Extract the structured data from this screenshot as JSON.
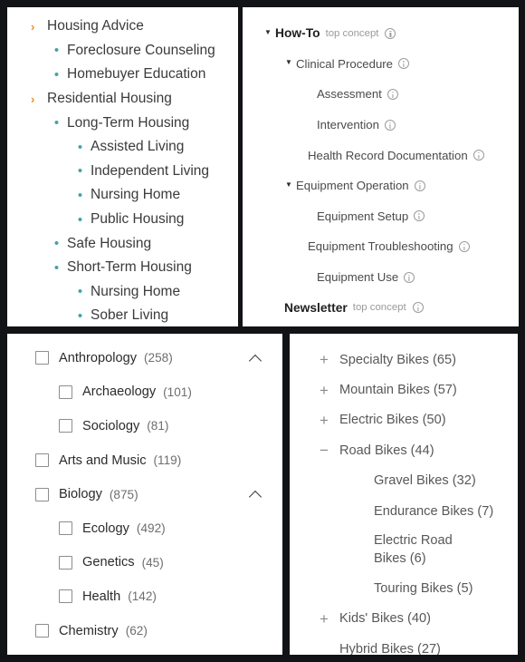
{
  "colors": {
    "background": "#121316",
    "panel": "#ffffff",
    "chevron_orange": "#e8912a",
    "bullet_teal": "#46a3a0",
    "text_primary": "#2b2b2e",
    "text_muted": "#9a9a9e"
  },
  "panel_housing": {
    "name": "Housing taxonomy tree",
    "items": [
      {
        "label": "Housing Advice",
        "marker": "chevron-right",
        "level": 0
      },
      {
        "label": "Foreclosure Counseling",
        "marker": "bullet",
        "level": 1
      },
      {
        "label": "Homebuyer Education",
        "marker": "bullet",
        "level": 1
      },
      {
        "label": "Residential Housing",
        "marker": "chevron-right",
        "level": 0
      },
      {
        "label": "Long-Term Housing",
        "marker": "bullet",
        "level": 1
      },
      {
        "label": "Assisted Living",
        "marker": "bullet",
        "level": 2
      },
      {
        "label": "Independent Living",
        "marker": "bullet",
        "level": 2
      },
      {
        "label": "Nursing Home",
        "marker": "bullet",
        "level": 2
      },
      {
        "label": "Public Housing",
        "marker": "bullet",
        "level": 2
      },
      {
        "label": "Safe Housing",
        "marker": "bullet",
        "level": 1
      },
      {
        "label": "Short-Term Housing",
        "marker": "bullet",
        "level": 1
      },
      {
        "label": "Nursing Home",
        "marker": "bullet",
        "level": 2
      },
      {
        "label": "Sober Living",
        "marker": "bullet",
        "level": 2
      }
    ],
    "chevron_glyph": "›",
    "bullet_glyph": "•"
  },
  "panel_howto": {
    "name": "How-To concept hierarchy",
    "caret_open_glyph": "▼",
    "items": [
      {
        "label": "How-To",
        "tag": "top concept",
        "caret": true,
        "bold": true,
        "depth": 0,
        "info": true
      },
      {
        "label": "Clinical Procedure",
        "tag": "",
        "caret": true,
        "bold": false,
        "depth": 1,
        "info": true
      },
      {
        "label": "Assessment",
        "tag": "",
        "caret": false,
        "bold": false,
        "depth": 2,
        "info": true
      },
      {
        "label": "Intervention",
        "tag": "",
        "caret": false,
        "bold": false,
        "depth": 2,
        "info": true
      },
      {
        "label": "Health Record Documentation",
        "tag": "",
        "caret": false,
        "bold": false,
        "depth": 2,
        "info": true
      },
      {
        "label": "Equipment Operation",
        "tag": "",
        "caret": true,
        "bold": false,
        "depth": 1,
        "info": true
      },
      {
        "label": "Equipment Setup",
        "tag": "",
        "caret": false,
        "bold": false,
        "depth": 2,
        "info": true
      },
      {
        "label": "Equipment Troubleshooting",
        "tag": "",
        "caret": false,
        "bold": false,
        "depth": 2,
        "info": true
      },
      {
        "label": "Equipment Use",
        "tag": "",
        "caret": false,
        "bold": false,
        "depth": 2,
        "info": true
      },
      {
        "label": "Newsletter",
        "tag": "top concept",
        "caret": false,
        "bold": true,
        "depth": 0,
        "info": true
      }
    ]
  },
  "panel_facets": {
    "name": "Subject facet checkbox list",
    "items": [
      {
        "label": "Anthropology",
        "count": "(258)",
        "level": 0,
        "checked": false,
        "collapse": true
      },
      {
        "label": "Archaeology",
        "count": "(101)",
        "level": 1,
        "checked": false,
        "collapse": false
      },
      {
        "label": "Sociology",
        "count": "(81)",
        "level": 1,
        "checked": false,
        "collapse": false
      },
      {
        "label": "Arts and Music",
        "count": "(119)",
        "level": 0,
        "checked": false,
        "collapse": false
      },
      {
        "label": "Biology",
        "count": "(875)",
        "level": 0,
        "checked": false,
        "collapse": true
      },
      {
        "label": "Ecology",
        "count": "(492)",
        "level": 1,
        "checked": false,
        "collapse": false
      },
      {
        "label": "Genetics",
        "count": "(45)",
        "level": 1,
        "checked": false,
        "collapse": false
      },
      {
        "label": "Health",
        "count": "(142)",
        "level": 1,
        "checked": false,
        "collapse": false
      },
      {
        "label": "Chemistry",
        "count": "(62)",
        "level": 0,
        "checked": false,
        "collapse": false
      }
    ]
  },
  "panel_bikes": {
    "name": "Bike category tree",
    "expand_glyph": "+",
    "collapse_glyph": "−",
    "items": [
      {
        "label": "Specialty Bikes (65)",
        "sign": "+",
        "level": 0,
        "wrap": false
      },
      {
        "label": "Mountain Bikes (57)",
        "sign": "+",
        "level": 0,
        "wrap": false
      },
      {
        "label": "Electric Bikes (50)",
        "sign": "+",
        "level": 0,
        "wrap": false
      },
      {
        "label": "Road Bikes (44)",
        "sign": "−",
        "level": 0,
        "wrap": false
      },
      {
        "label": "Gravel Bikes (32)",
        "sign": "",
        "level": 1,
        "wrap": false
      },
      {
        "label": "Endurance Bikes (7)",
        "sign": "",
        "level": 1,
        "wrap": false
      },
      {
        "label": "Electric Road Bikes (6)",
        "sign": "",
        "level": 1,
        "wrap": true
      },
      {
        "label": "Touring Bikes (5)",
        "sign": "",
        "level": 1,
        "wrap": false
      },
      {
        "label": "Kids' Bikes (40)",
        "sign": "+",
        "level": 0,
        "wrap": false
      },
      {
        "label": "Hybrid Bikes (27)",
        "sign": "",
        "level": 0,
        "wrap": false
      }
    ]
  }
}
